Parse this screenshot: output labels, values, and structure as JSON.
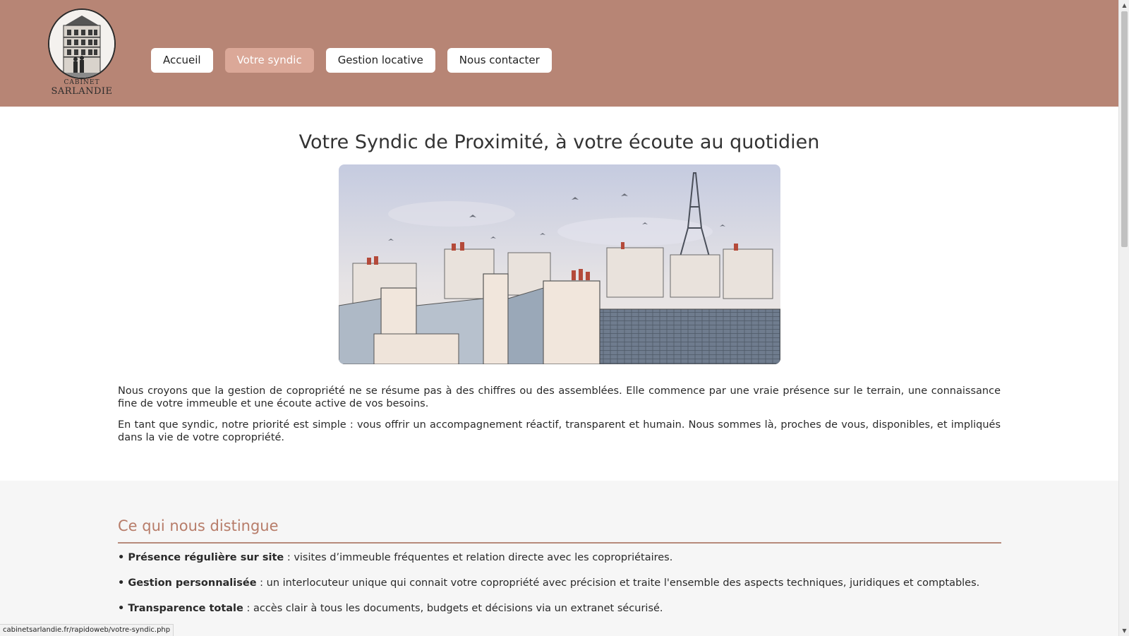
{
  "brand": {
    "logo_line1": "CABINET",
    "logo_line2": "SARLANDIE",
    "header_color": "#b78575"
  },
  "nav": {
    "items": [
      {
        "label": "Accueil",
        "active": false
      },
      {
        "label": "Votre syndic",
        "active": true
      },
      {
        "label": "Gestion locative",
        "active": false
      },
      {
        "label": "Nous contacter",
        "active": false
      }
    ],
    "active_color": "#dba898"
  },
  "main": {
    "title": "Votre Syndic de Proximité, à votre écoute au quotidien",
    "intro": [
      "Nous croyons que la gestion de copropriété ne se résume pas à des chiffres ou des assemblées. Elle commence par une vraie présence sur le terrain, une connaissance fine de votre immeuble et une écoute active de vos besoins.",
      "En tant que syndic, notre priorité est simple : vous offrir un accompagnement réactif, transparent et humain. Nous sommes là, proches de vous, disponibles, et impliqués dans la vie de votre copropriété."
    ]
  },
  "distinguish": {
    "title": "Ce qui nous distingue",
    "accent_color": "#b77c69",
    "items": [
      {
        "bold": "• Présence régulière sur site",
        "text": " : visites d’immeuble fréquentes et relation directe avec les copropriétaires."
      },
      {
        "bold": "• Gestion personnalisée",
        "text": " : un interlocuteur unique qui connait votre copropriété avec précision et traite l'ensemble des aspects techniques, juridiques et comptables."
      },
      {
        "bold": "• Transparence totale",
        "text": " : accès clair à tous les documents, budgets et décisions via un extranet sécurisé."
      }
    ]
  },
  "status_bar": {
    "url": "cabinetsarlandie.fr/rapidoweb/votre-syndic.php"
  },
  "icons": {
    "scroll_up": "chevron-up-icon",
    "scroll_down": "chevron-down-icon"
  }
}
